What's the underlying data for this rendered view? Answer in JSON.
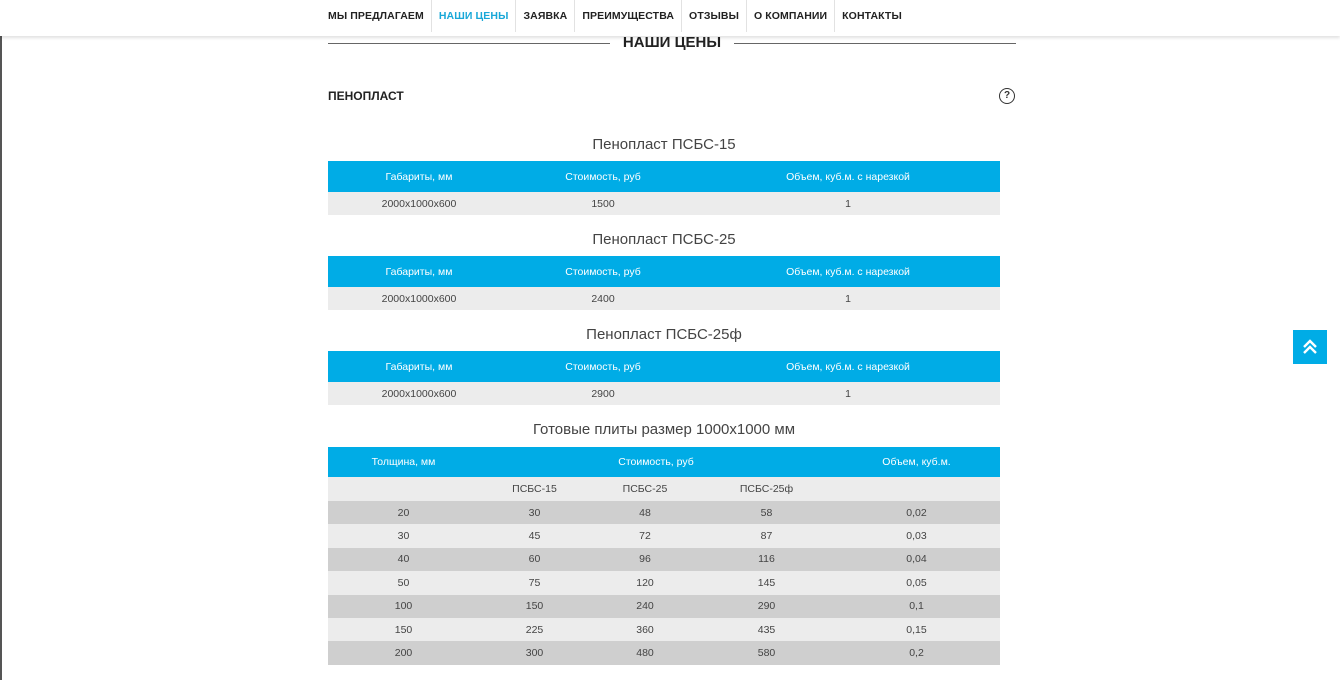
{
  "nav": {
    "items": [
      {
        "label": "МЫ ПРЕДЛАГАЕМ",
        "active": false
      },
      {
        "label": "НАШИ ЦЕНЫ",
        "active": true
      },
      {
        "label": "ЗАЯВКА",
        "active": false
      },
      {
        "label": "ПРЕИМУЩЕСТВА",
        "active": false
      },
      {
        "label": "ОТЗЫВЫ",
        "active": false
      },
      {
        "label": "О КОМПАНИИ",
        "active": false
      },
      {
        "label": "КОНТАКТЫ",
        "active": false
      }
    ]
  },
  "section": {
    "title": "НАШИ ЦЕНЫ",
    "category": "ПЕНОПЛАСТ",
    "help_icon": "question-circle-icon",
    "help_label": "?"
  },
  "tables": [
    {
      "title": "Пенопласт ПСБС-15",
      "headers": [
        "Габариты, мм",
        "Стоимость, руб",
        "Объем, куб.м. с нарезкой"
      ],
      "row": [
        "2000x1000x600",
        "1500",
        "1"
      ]
    },
    {
      "title": "Пенопласт ПСБС-25",
      "headers": [
        "Габариты, мм",
        "Стоимость, руб",
        "Объем, куб.м. с нарезкой"
      ],
      "row": [
        "2000x1000x600",
        "2400",
        "1"
      ]
    },
    {
      "title": "Пенопласт ПСБС-25ф",
      "headers": [
        "Габариты, мм",
        "Стоимость, руб",
        "Объем, куб.м. с нарезкой"
      ],
      "row": [
        "2000x1000x600",
        "2900",
        "1"
      ]
    }
  ],
  "plates": {
    "title": "Готовые плиты размер 1000x1000 мм",
    "headers": [
      "Толщина, мм",
      "Стоимость, руб",
      "Объем, куб.м."
    ],
    "subheaders": [
      "ПСБС-15",
      "ПСБС-25",
      "ПСБС-25ф"
    ],
    "rows": [
      [
        "20",
        "30",
        "48",
        "58",
        "0,02"
      ],
      [
        "30",
        "45",
        "72",
        "87",
        "0,03"
      ],
      [
        "40",
        "60",
        "96",
        "116",
        "0,04"
      ],
      [
        "50",
        "75",
        "120",
        "145",
        "0,05"
      ],
      [
        "100",
        "150",
        "240",
        "290",
        "0,1"
      ],
      [
        "150",
        "225",
        "360",
        "435",
        "0,15"
      ],
      [
        "200",
        "300",
        "480",
        "580",
        "0,2"
      ]
    ]
  },
  "to_top": {
    "icon": "double-chevron-up-icon"
  },
  "colors": {
    "accent": "#00ace6",
    "nav_active": "#19a8d8",
    "row_light": "#ececec",
    "row_dark": "#cfcfcf"
  }
}
